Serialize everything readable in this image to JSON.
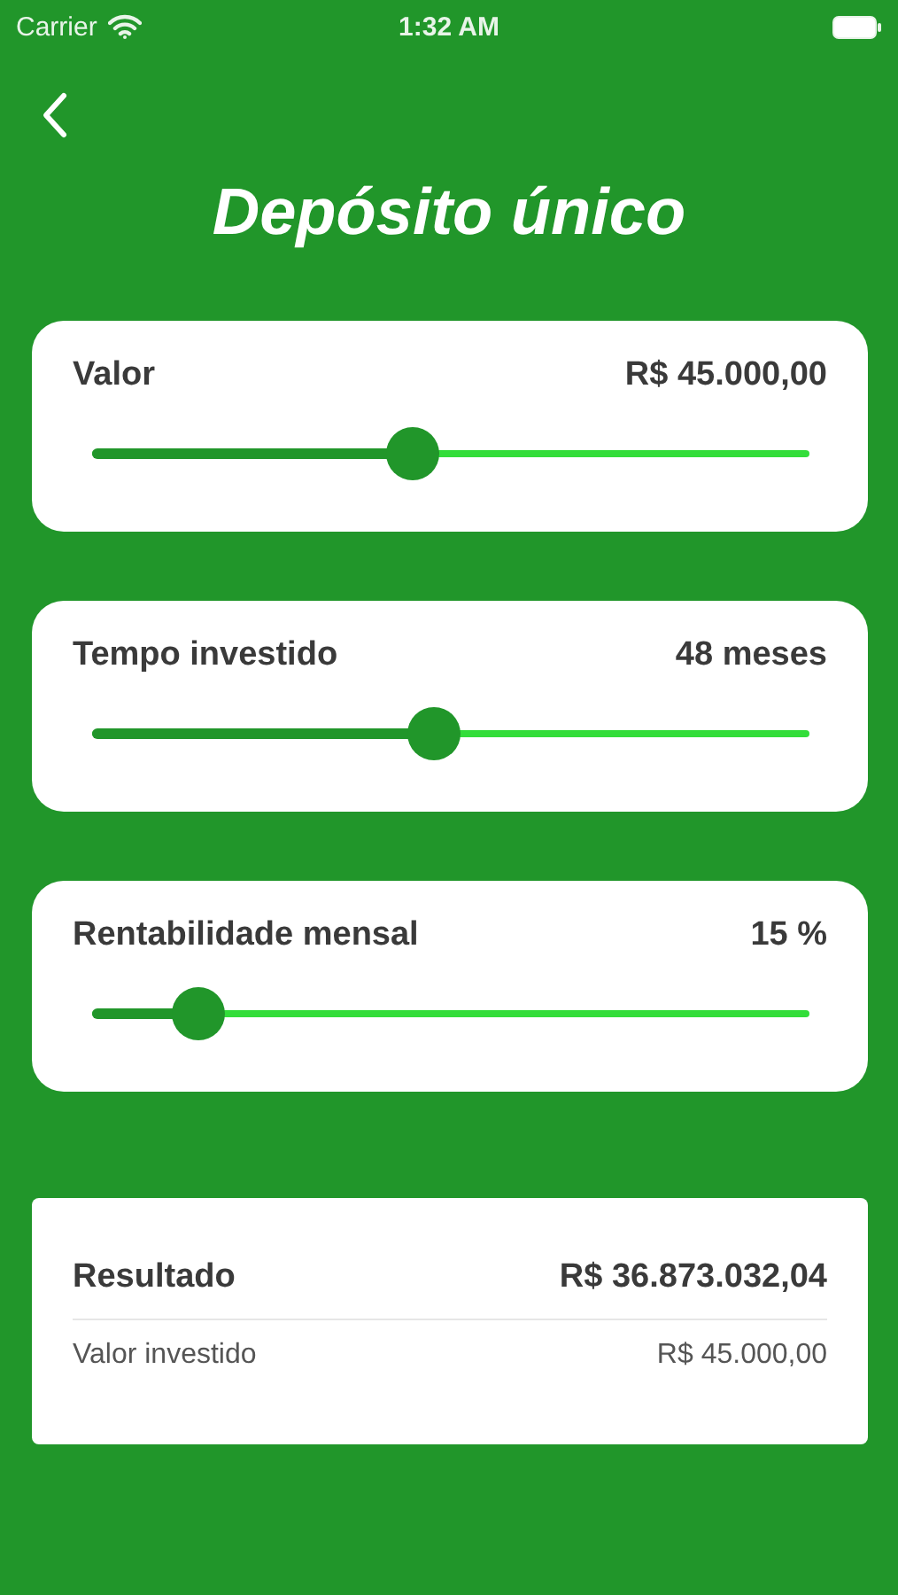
{
  "status_bar": {
    "carrier": "Carrier",
    "time": "1:32 AM"
  },
  "title": "Depósito único",
  "sliders": [
    {
      "label": "Valor",
      "reading": "R$ 45.000,00",
      "level": 0.447
    },
    {
      "label": "Tempo investido",
      "reading": "48 meses",
      "level": 0.477
    },
    {
      "label": "Rentabilidade mensal",
      "reading": "15 %",
      "level": 0.148
    }
  ],
  "result": {
    "label": "Resultado",
    "value": "R$ 36.873.032,04",
    "detail_label": "Valor investido",
    "detail_value": "R$ 45.000,00"
  }
}
